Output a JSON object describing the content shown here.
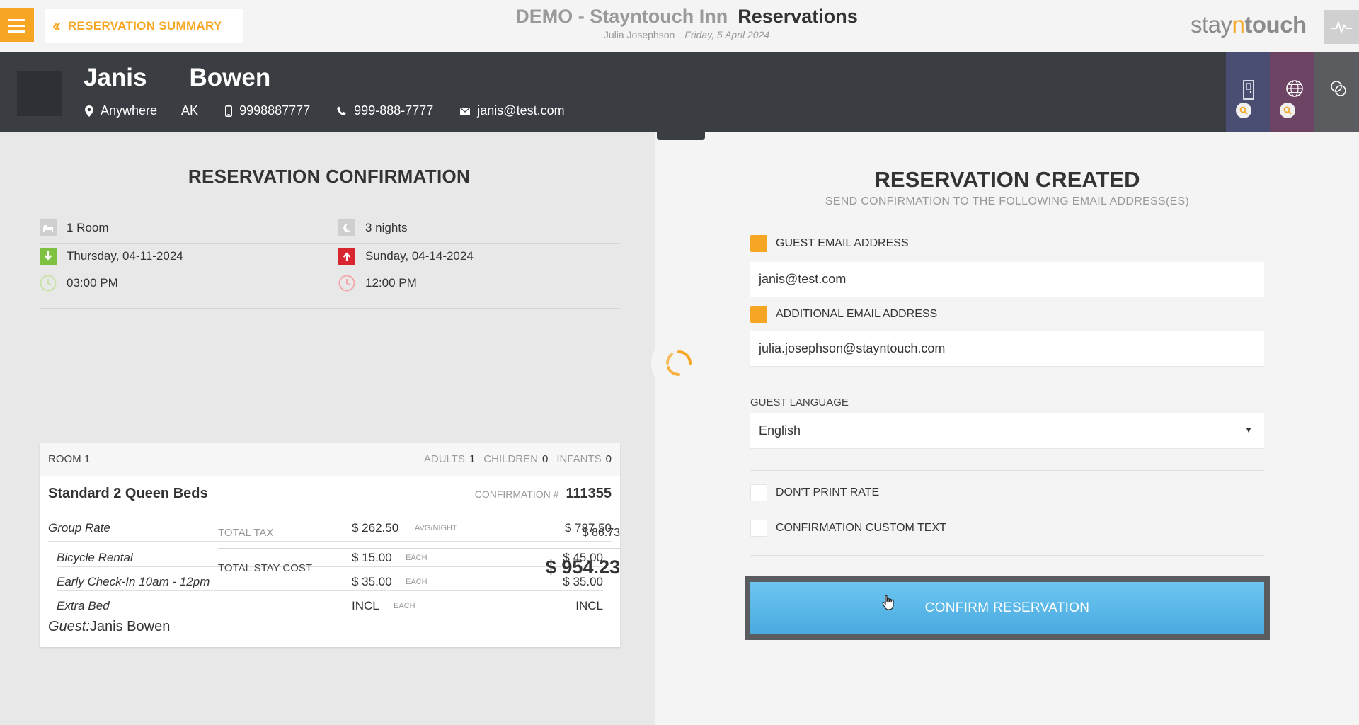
{
  "header": {
    "back_label": "RESERVATION SUMMARY",
    "hotel": "DEMO - Stayntouch Inn",
    "module": "Reservations",
    "user": "Julia Josephson",
    "date": "Friday, 5 April 2024",
    "logo_a": "stay",
    "logo_n": "n",
    "logo_b": "touch"
  },
  "guest": {
    "first_name": "Janis",
    "last_name": "Bowen",
    "city": "Anywhere",
    "state": "AK",
    "mobile": "9998887777",
    "phone": "999-888-7777",
    "email": "janis@test.com"
  },
  "confirmation": {
    "title": "RESERVATION CONFIRMATION",
    "rooms": "1 Room",
    "nights": "3 nights",
    "arrival_date": "Thursday, 04-11-2024",
    "departure_date": "Sunday, 04-14-2024",
    "arrival_time": "03:00 PM",
    "departure_time": "12:00 PM",
    "room": {
      "label": "ROOM 1",
      "adults_label": "ADULTS",
      "adults": "1",
      "children_label": "CHILDREN",
      "children": "0",
      "infants_label": "INFANTS",
      "infants": "0",
      "type": "Standard 2 Queen Beds",
      "confirmation_label": "CONFIRMATION #",
      "confirmation_no": "111355",
      "rate": {
        "name": "Group Rate",
        "price": "$ 262.50",
        "unit": "AVG/NIGHT",
        "total": "$ 787.50"
      },
      "addons": [
        {
          "name": "Bicycle Rental",
          "price": "$ 15.00",
          "unit": "EACH",
          "total": "$ 45.00"
        },
        {
          "name": "Early Check-In 10am - 12pm",
          "price": "$ 35.00",
          "unit": "EACH",
          "total": "$ 35.00"
        },
        {
          "name": "Extra Bed",
          "price": "INCL",
          "unit": "EACH",
          "total": "INCL"
        }
      ],
      "guest_label": "Guest:",
      "guest_name": "Janis Bowen"
    },
    "total_tax_label": "TOTAL TAX",
    "total_tax": "$ 86.73",
    "total_stay_label": "TOTAL STAY COST",
    "total_stay": "$ 954.23"
  },
  "created": {
    "title": "RESERVATION CREATED",
    "subtitle": "SEND CONFIRMATION TO THE FOLLOWING EMAIL ADDRESS(ES)",
    "guest_email_label": "GUEST EMAIL ADDRESS",
    "guest_email": "janis@test.com",
    "additional_email_label": "ADDITIONAL EMAIL ADDRESS",
    "additional_email": "julia.josephson@stayntouch.com",
    "language_label": "GUEST LANGUAGE",
    "language": "English",
    "dont_print_rate": "DON'T PRINT RATE",
    "custom_text": "CONFIRMATION CUSTOM TEXT",
    "confirm_button": "CONFIRM RESERVATION"
  },
  "colors": {
    "accent": "#f6a623",
    "guestbar": "#3a3d42",
    "button": "#4aa9e0"
  }
}
